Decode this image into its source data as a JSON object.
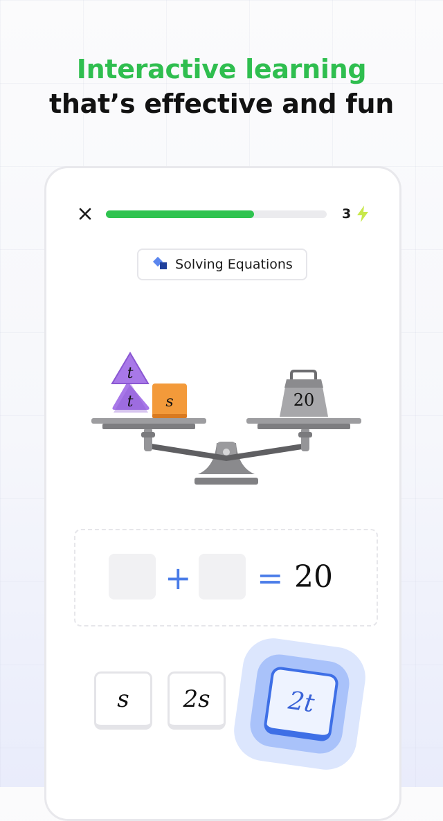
{
  "headline": {
    "line1": "Interactive learning",
    "line2": "that’s effective and fun"
  },
  "progress": {
    "fraction": 0.67,
    "streak": "3",
    "close_icon": "close-icon",
    "streak_icon": "lightning-bolt-icon"
  },
  "chip": {
    "label": "Solving Equations",
    "icon": "equations-diamond-icon"
  },
  "scale": {
    "left_pan": [
      {
        "shape": "triangle",
        "label": "t"
      },
      {
        "shape": "triangle",
        "label": "t"
      },
      {
        "shape": "square",
        "label": "s"
      }
    ],
    "right_pan": {
      "shape": "weight",
      "label": "20"
    }
  },
  "equation": {
    "plus": "+",
    "equals": "=",
    "rhs": "20"
  },
  "answers": [
    {
      "label": "s",
      "selected": false
    },
    {
      "label": "2s",
      "selected": false
    },
    {
      "label": "2t",
      "selected": true
    }
  ],
  "colors": {
    "green": "#2fbe4f",
    "accent_blue": "#3e6fe6",
    "triangle": "#a878e8",
    "square": "#f39a3a"
  }
}
